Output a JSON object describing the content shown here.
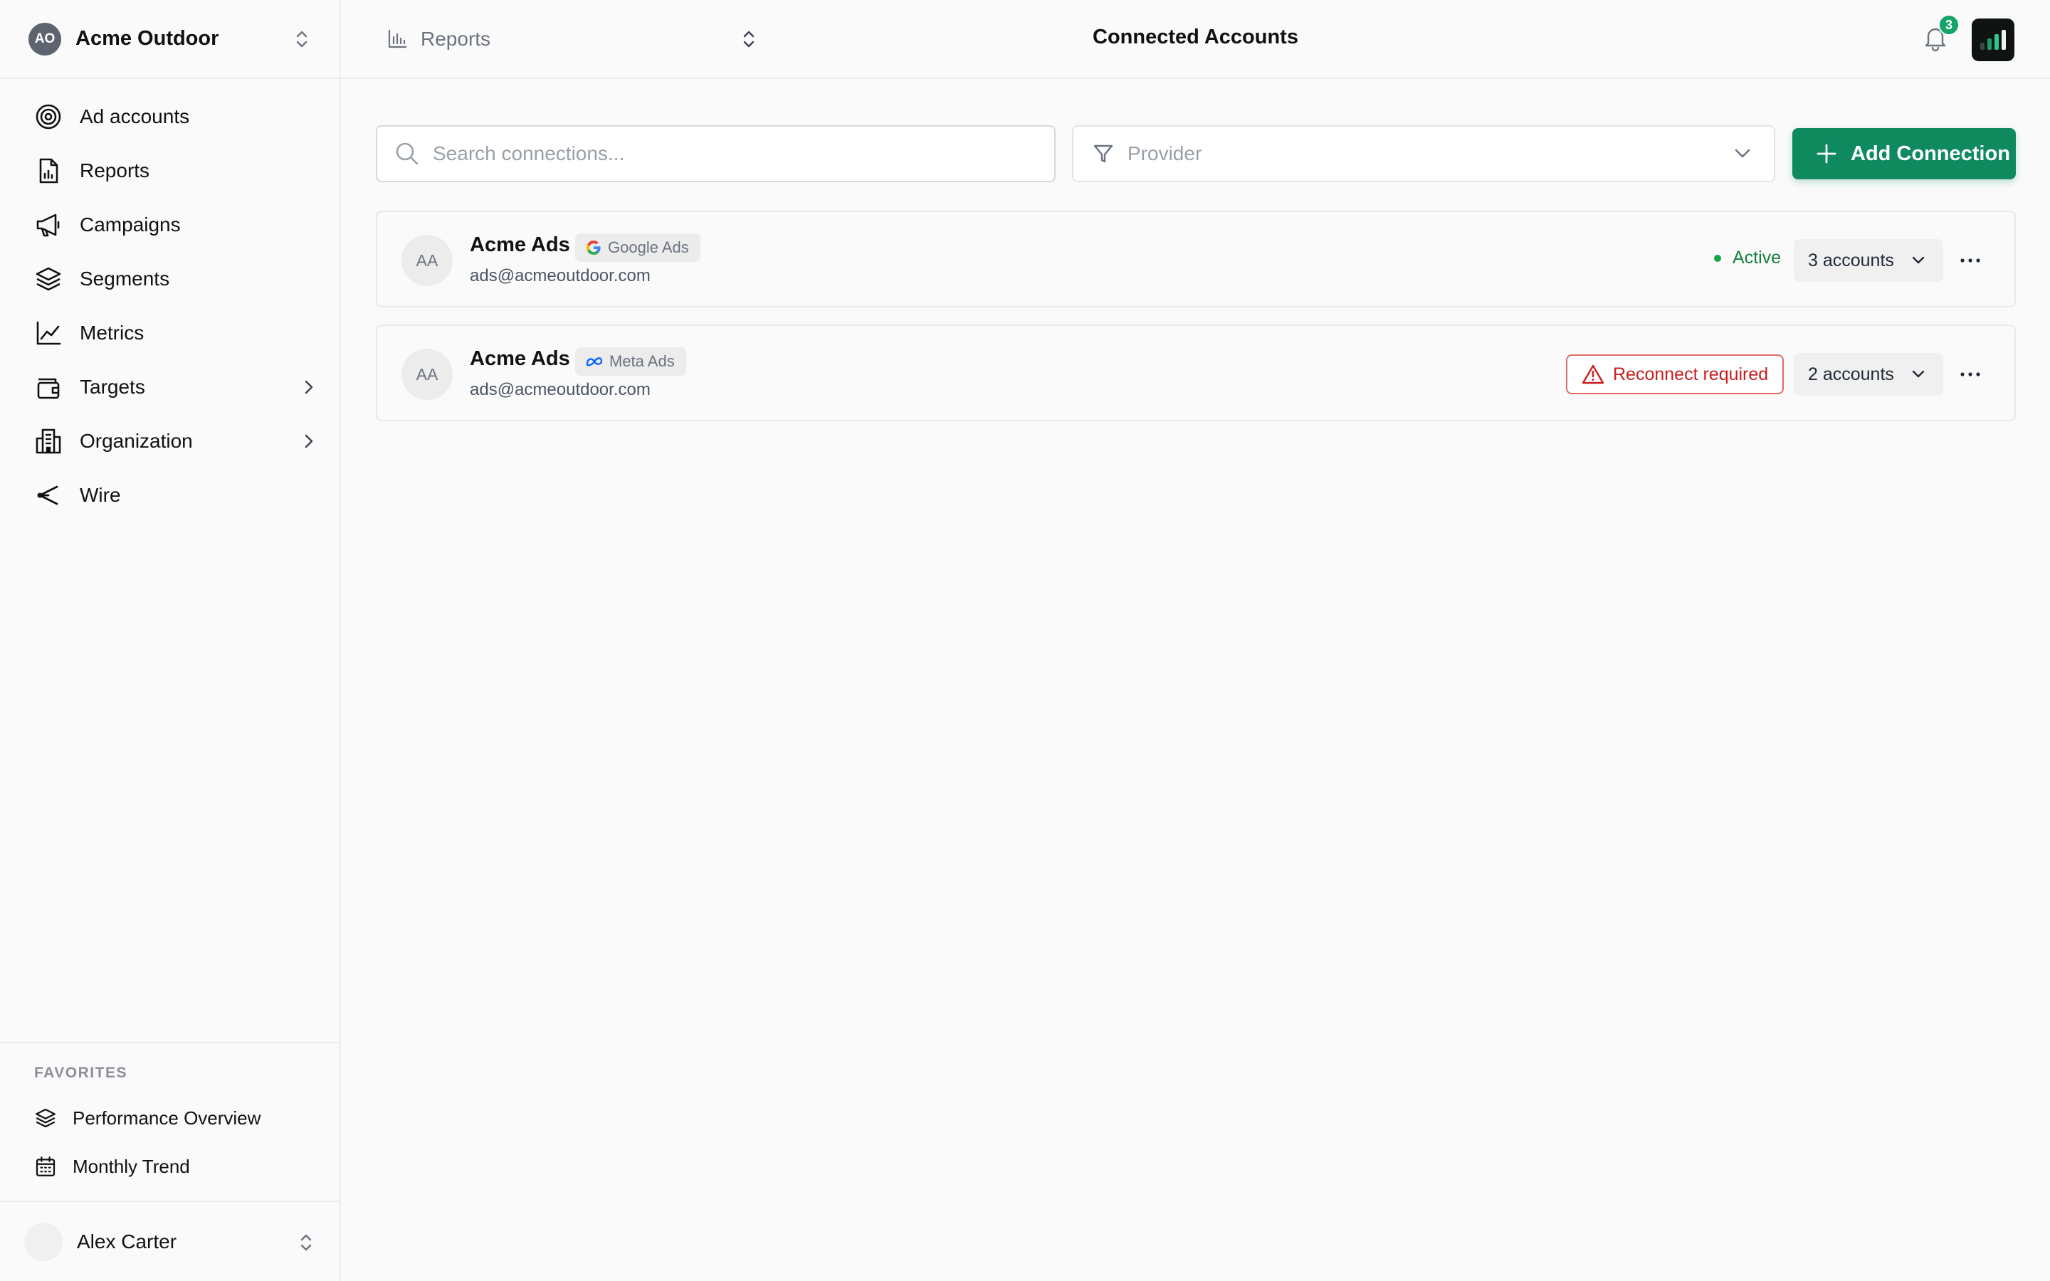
{
  "colors": {
    "accent": "#0f8a5f",
    "active_status": "#15803d",
    "error_status": "#c81e1e",
    "notification_badge": "#16a36a"
  },
  "org": {
    "initials": "AO",
    "name": "Acme Outdoor"
  },
  "sidebar": {
    "items": [
      {
        "label": "Ad accounts",
        "icon": "target-icon"
      },
      {
        "label": "Reports",
        "icon": "report-file-icon"
      },
      {
        "label": "Campaigns",
        "icon": "megaphone-icon"
      },
      {
        "label": "Segments",
        "icon": "layers-icon"
      },
      {
        "label": "Metrics",
        "icon": "line-chart-icon"
      },
      {
        "label": "Targets",
        "icon": "wallet-icon",
        "has_submenu": true
      },
      {
        "label": "Organization",
        "icon": "building-icon",
        "has_submenu": true
      },
      {
        "label": "Wire",
        "icon": "share-node-icon"
      }
    ],
    "favorites": {
      "heading": "FAVORITES",
      "items": [
        {
          "label": "Performance Overview",
          "icon": "layers-icon"
        },
        {
          "label": "Monthly Trend",
          "icon": "calendar-icon"
        }
      ]
    },
    "user": {
      "name": "Alex Carter"
    }
  },
  "header": {
    "report_switch_label": "Reports",
    "title": "Connected Accounts",
    "notification_count": "3"
  },
  "toolbar": {
    "search_placeholder": "Search connections...",
    "provider_placeholder": "Provider",
    "add_button_label": "Add Connection"
  },
  "connections": [
    {
      "initials": "AA",
      "name": "Acme Ads",
      "provider": "Google Ads",
      "provider_icon": "google-icon",
      "email": "ads@acmeoutdoor.com",
      "status": "Active",
      "accounts": "3 accounts"
    },
    {
      "initials": "AA",
      "name": "Acme Ads",
      "provider": "Meta Ads",
      "provider_icon": "meta-icon",
      "email": "ads@acmeoutdoor.com",
      "status": "Reconnect required",
      "accounts": "2 accounts"
    }
  ]
}
